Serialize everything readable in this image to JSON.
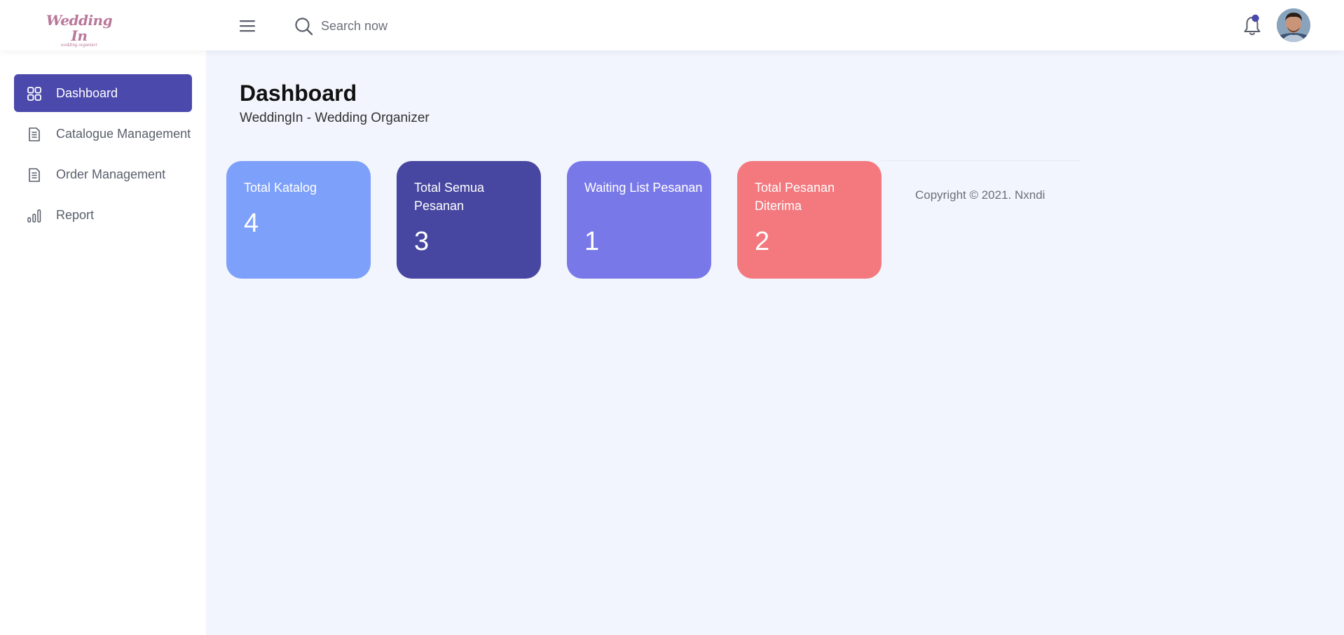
{
  "header": {
    "logo_title": "Wedding In",
    "logo_subtitle": "wedding organizer",
    "search_placeholder": "Search now",
    "notification_dot_color": "#4b49ac"
  },
  "sidebar": {
    "items": [
      {
        "label": "Dashboard",
        "icon": "grid-icon",
        "active": true
      },
      {
        "label": "Catalogue Management",
        "icon": "document-icon",
        "active": false
      },
      {
        "label": "Order Management",
        "icon": "document-icon",
        "active": false
      },
      {
        "label": "Report",
        "icon": "bar-chart-icon",
        "active": false
      }
    ]
  },
  "main": {
    "title": "Dashboard",
    "subtitle": "WeddingIn - Wedding Organizer",
    "cards": [
      {
        "label": "Total Katalog",
        "value": "4",
        "color": "#7da0fa"
      },
      {
        "label": "Total Semua Pesanan",
        "value": "3",
        "color": "#4747a1"
      },
      {
        "label": "Waiting List Pesanan",
        "value": "1",
        "color": "#7978e9"
      },
      {
        "label": "Total Pesanan Diterima",
        "value": "2",
        "color": "#f3797e"
      }
    ]
  },
  "footer": {
    "copyright": "Copyright © 2021. Nxndi"
  },
  "theme": {
    "accent": "#4b49ac",
    "background": "#f2f5fd"
  }
}
